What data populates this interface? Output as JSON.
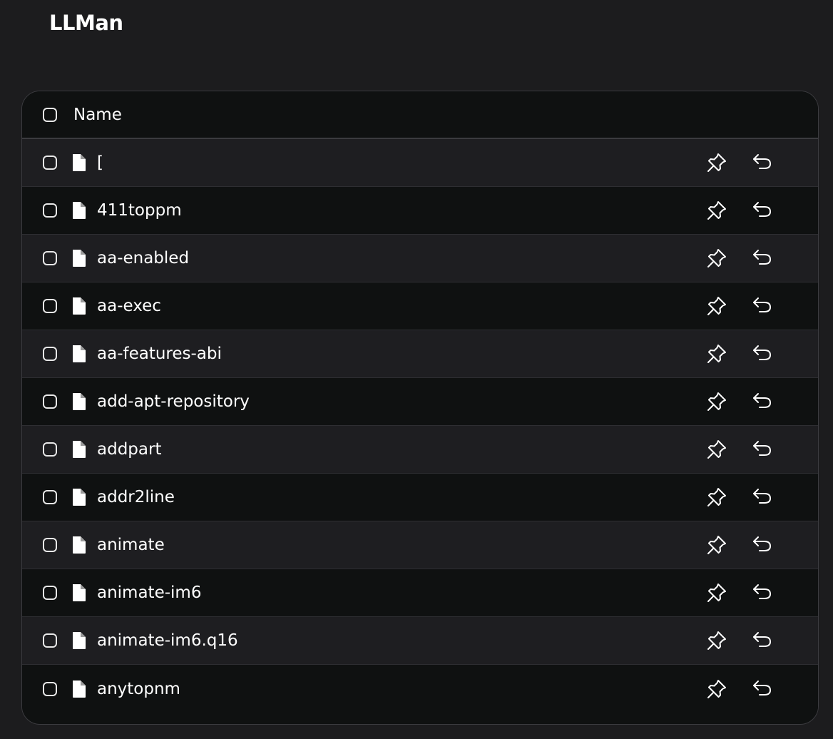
{
  "app": {
    "title": "LLMan"
  },
  "table": {
    "header": {
      "name_label": "Name"
    },
    "rows": [
      {
        "name": "["
      },
      {
        "name": "411toppm"
      },
      {
        "name": "aa-enabled"
      },
      {
        "name": "aa-exec"
      },
      {
        "name": "aa-features-abi"
      },
      {
        "name": "add-apt-repository"
      },
      {
        "name": "addpart"
      },
      {
        "name": "addr2line"
      },
      {
        "name": "animate"
      },
      {
        "name": "animate-im6"
      },
      {
        "name": "animate-im6.q16"
      },
      {
        "name": "anytopnm"
      }
    ]
  },
  "icons": {
    "row_icon": "file-icon",
    "pin": "pin-icon",
    "undo": "undo-icon"
  },
  "colors": {
    "background": "#1c1c1e",
    "table_dark": "#0f1111",
    "table_alt": "#1e1e21",
    "border": "#3b3b3f",
    "text": "#ffffff"
  }
}
